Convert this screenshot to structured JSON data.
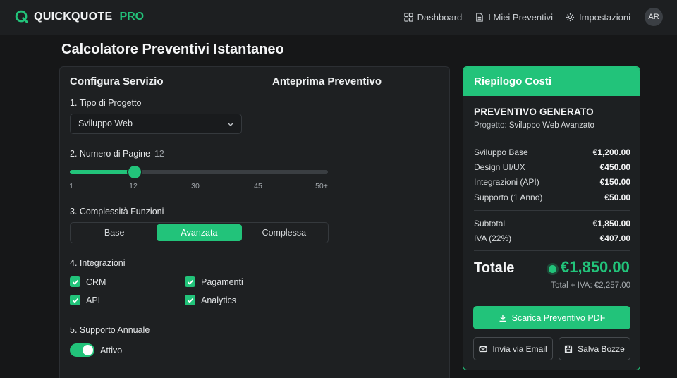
{
  "app": {
    "brand_main": "QUICKQUOTE",
    "brand_accent": "PRO"
  },
  "nav": {
    "items": [
      {
        "label": "Dashboard",
        "icon": "dashboard-grid-icon"
      },
      {
        "label": "I Miei Preventivi",
        "icon": "document-icon"
      },
      {
        "label": "Impostazioni",
        "icon": "gear-icon"
      }
    ],
    "avatar": "AR"
  },
  "page": {
    "title": "Calcolatore Preventivi Istantaneo"
  },
  "config": {
    "heading": "Configura Servizio",
    "preview_heading": "Anteprima Preventivo",
    "project_type": {
      "label": "1. Tipo di Progetto",
      "value": "Sviluppo Web"
    },
    "pages": {
      "label": "2. Numero di Pagine",
      "value": 12,
      "value_text": "12",
      "min": 1,
      "max": 50,
      "ticks": [
        "1",
        "12",
        "30",
        "45",
        "50+"
      ]
    },
    "complexity": {
      "label": "3. Complessità Funzioni",
      "options": [
        "Base",
        "Avanzata",
        "Complessa"
      ],
      "selected": "Avanzata"
    },
    "integrations": {
      "label": "4. Integrazioni",
      "items": [
        {
          "label": "CRM",
          "checked": true
        },
        {
          "label": "Pagamenti",
          "checked": true
        },
        {
          "label": "API",
          "checked": true
        },
        {
          "label": "Analytics",
          "checked": true
        }
      ]
    },
    "support": {
      "label": "5. Supporto Annuale",
      "toggle_label": "Attivo",
      "on": true
    }
  },
  "summary": {
    "heading": "Riepilogo Costi",
    "title": "PREVENTIVO GENERATO",
    "project_label": "Progetto:",
    "project_value": "Sviluppo Web Avanzato",
    "lines": [
      {
        "label": "Sviluppo Base",
        "value": "€1,200.00"
      },
      {
        "label": "Design UI/UX",
        "value": "€450.00"
      },
      {
        "label": "Integrazioni (API)",
        "value": "€150.00"
      },
      {
        "label": "Supporto (1 Anno)",
        "value": "€50.00"
      }
    ],
    "subtotal": {
      "label": "Subtotal",
      "value": "€1,850.00"
    },
    "vat": {
      "label": "IVA (22%)",
      "value": "€407.00"
    },
    "total": {
      "label": "Totale",
      "value": "€1,850.00",
      "with_vat": "Total + IVA: €2,257.00"
    },
    "buttons": {
      "download": "Scarica Preventivo PDF",
      "email": "Invia via Email",
      "save": "Salva Bozze"
    }
  },
  "colors": {
    "accent": "#22c37a",
    "background": "#161718",
    "panel": "#1e2022"
  }
}
